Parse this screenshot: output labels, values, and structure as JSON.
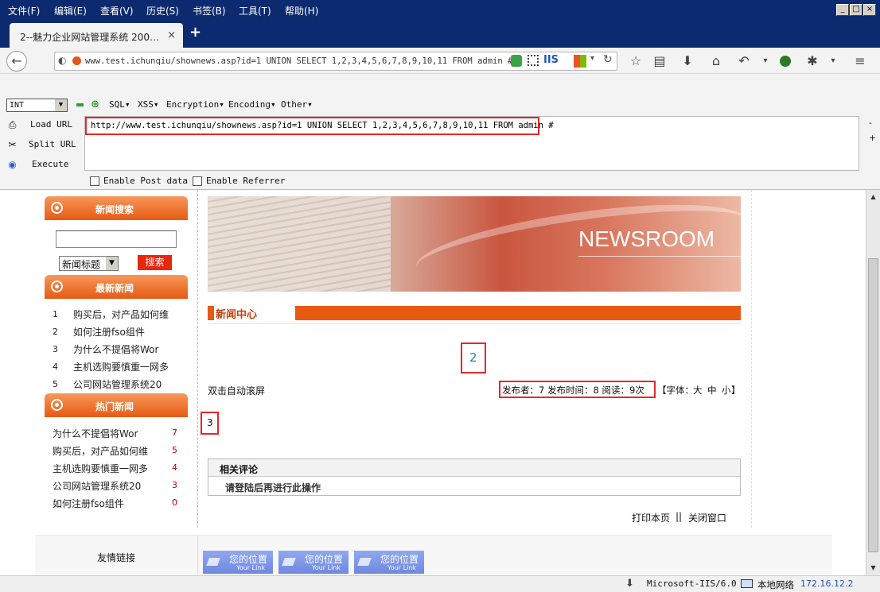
{
  "menubar": {
    "items": [
      "文件(F)",
      "编辑(E)",
      "查看(V)",
      "历史(S)",
      "书签(B)",
      "工具(T)",
      "帮助(H)"
    ]
  },
  "tab": {
    "title": "2--魅力企业网站管理系统 200…",
    "close": "×",
    "new_tab": "+"
  },
  "address": {
    "url": "www.test.ichunqiu/shownews.asp?id=1 UNION SELECT 1,2,3,4,5,6,7,8,9,10,11 FROM admin #",
    "iis_badge": "IIS"
  },
  "hackbar": {
    "type_select": "INT",
    "menus": [
      "SQL▾",
      "XSS▾",
      "Encryption▾",
      "Encoding▾",
      "Other▾"
    ],
    "actions": [
      "Load URL",
      "Split URL",
      "Execute"
    ],
    "url_value": "http://www.test.ichunqiu/shownews.asp?id=1 UNION SELECT 1,2,3,4,5,6,7,8,9,10,11 FROM admin #",
    "enable_post": "Enable Post data",
    "enable_referrer": "Enable Referrer",
    "zoom_minus": "-",
    "zoom_plus": "+"
  },
  "sidebar": {
    "search_title": "新闻搜索",
    "search_select": "新闻标题",
    "search_button": "搜索",
    "latest_title": "最新新闻",
    "latest": [
      {
        "num": "1",
        "text": "购买后，对产品如何维"
      },
      {
        "num": "2",
        "text": "如何注册fso组件"
      },
      {
        "num": "3",
        "text": "为什么不提倡将Wor"
      },
      {
        "num": "4",
        "text": "主机选购要慎重一网多"
      },
      {
        "num": "5",
        "text": "公司网站管理系统20"
      }
    ],
    "hot_title": "热门新闻",
    "hot": [
      {
        "text": "为什么不提倡将Wor",
        "count": "7"
      },
      {
        "text": "购买后，对产品如何维",
        "count": "5"
      },
      {
        "text": "主机选购要慎重一网多",
        "count": "4"
      },
      {
        "text": "公司网站管理系统20",
        "count": "3"
      },
      {
        "text": "如何注册fso组件",
        "count": "0"
      }
    ],
    "links_title": "友情链接"
  },
  "main": {
    "banner_text": "NEWSROOM",
    "section_title": "新闻中心",
    "news_title": "2",
    "auto_scroll": "双击自动滚屏",
    "meta": "发布者：7 发布时间：8 阅读：9次",
    "font_label": "【字体：",
    "font_large": "大",
    "font_mid": "中",
    "font_small": "小",
    "font_end": "】",
    "content": "3",
    "comments_title": "相关评论",
    "comments_login": "请登陆后再进行此操作",
    "print": "打印本页",
    "sep": "||",
    "close": "关闭窗口"
  },
  "footer_buttons": [
    {
      "t1": "您的位置",
      "t2": "Your Link"
    },
    {
      "t1": "您的位置",
      "t2": "Your Link"
    },
    {
      "t1": "您的位置",
      "t2": "Your Link"
    }
  ],
  "status": {
    "server": "Microsoft-IIS/6.0",
    "network": "本地网络",
    "ip": "172.16.12.2"
  }
}
